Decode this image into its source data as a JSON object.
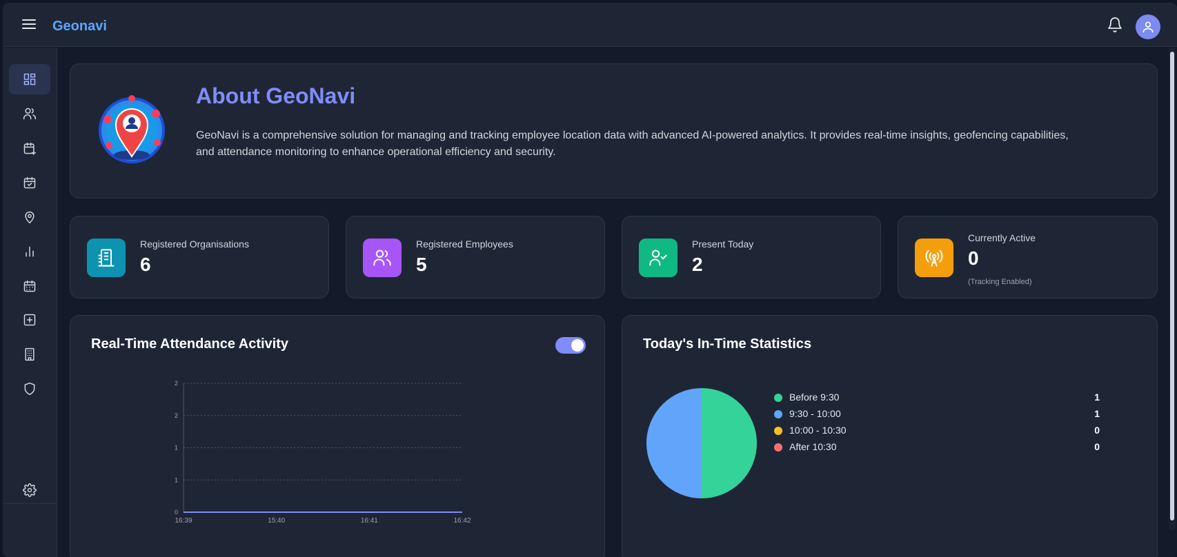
{
  "app": {
    "brand": "Geonavi"
  },
  "header": {
    "notification_icon": "bell-icon",
    "avatar_icon": "user-icon"
  },
  "sidebar": {
    "items": [
      {
        "icon": "dashboard-icon",
        "active": true
      },
      {
        "icon": "users-icon"
      },
      {
        "icon": "calendar-plus-icon"
      },
      {
        "icon": "calendar-check-icon"
      },
      {
        "icon": "map-pin-icon"
      },
      {
        "icon": "bar-chart-icon"
      },
      {
        "icon": "calendar-icon"
      },
      {
        "icon": "plus-square-icon"
      },
      {
        "icon": "building-icon"
      },
      {
        "icon": "shield-icon"
      }
    ],
    "settings_icon": "gear-icon"
  },
  "about": {
    "title": "About GeoNavi",
    "description": "GeoNavi is a comprehensive solution for managing and tracking employee location data with advanced AI-powered analytics. It provides real-time insights, geofencing capabilities, and attendance monitoring to enhance operational efficiency and security."
  },
  "stats": [
    {
      "label": "Registered Organisations",
      "value": "6",
      "icon": "building-icon",
      "color": "#0e92b2"
    },
    {
      "label": "Registered Employees",
      "value": "5",
      "icon": "users-icon",
      "color": "#a855f7"
    },
    {
      "label": "Present Today",
      "value": "2",
      "icon": "user-check-icon",
      "color": "#10b981"
    },
    {
      "label": "Currently Active",
      "value": "0",
      "note": "(Tracking Enabled)",
      "icon": "broadcast-icon",
      "color": "#f59e0b"
    }
  ],
  "activity": {
    "title": "Real-Time Attendance Activity",
    "toggle_on": true
  },
  "intime": {
    "title": "Today's In-Time Statistics",
    "legend": [
      {
        "label": "Before 9:30",
        "count": "1",
        "color": "#34d399"
      },
      {
        "label": "9:30 - 10:00",
        "count": "1",
        "color": "#60a5fa"
      },
      {
        "label": "10:00 - 10:30",
        "count": "0",
        "color": "#fbbf24"
      },
      {
        "label": "After 10:30",
        "count": "0",
        "color": "#f87171"
      }
    ]
  },
  "chart_data": [
    {
      "type": "line",
      "x": [
        "16:39",
        "15:40",
        "16:41",
        "16:42"
      ],
      "y_tick_labels": [
        "0",
        "1",
        "1",
        "2",
        "2"
      ],
      "ylim": [
        0,
        2
      ],
      "grid": true,
      "series": [
        {
          "values": [
            0,
            0,
            0,
            0
          ],
          "color": "#818cf8"
        }
      ]
    },
    {
      "type": "pie",
      "categories": [
        "Before 9:30",
        "9:30 - 10:00",
        "10:00 - 10:30",
        "After 10:30"
      ],
      "values": [
        1,
        1,
        0,
        0
      ],
      "colors": [
        "#34d399",
        "#60a5fa",
        "#fbbf24",
        "#f87171"
      ]
    }
  ]
}
